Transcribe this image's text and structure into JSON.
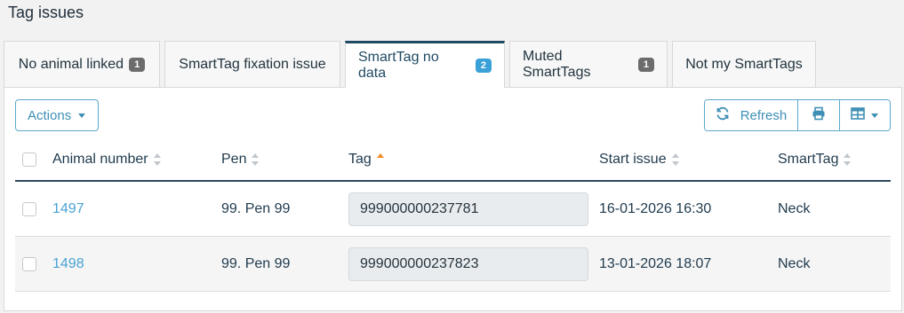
{
  "page": {
    "title": "Tag issues"
  },
  "tabs": [
    {
      "label": "No animal linked",
      "badge": "1"
    },
    {
      "label": "SmartTag fixation issue",
      "badge": ""
    },
    {
      "label": "SmartTag no data",
      "badge": "2"
    },
    {
      "label": "Muted SmartTags",
      "badge": "1"
    },
    {
      "label": "Not my SmartTags",
      "badge": ""
    }
  ],
  "toolbar": {
    "actions_label": "Actions",
    "refresh_label": "Refresh"
  },
  "table": {
    "columns": [
      "Animal number",
      "Pen",
      "Tag",
      "Start issue",
      "SmartTag"
    ],
    "sorted_column": "Tag",
    "sort_direction": "ascending",
    "rows": [
      {
        "animal_number": "1497",
        "pen": "99. Pen 99",
        "tag": "999000000237781",
        "start_issue": "16-01-2026 16:30",
        "smarttag": "Neck"
      },
      {
        "animal_number": "1498",
        "pen": "99. Pen 99",
        "tag": "999000000237823",
        "start_issue": "13-01-2026 18:07",
        "smarttag": "Neck"
      }
    ]
  },
  "icons": {
    "refresh": "refresh-icon",
    "print": "printer-icon",
    "view": "table-view-icon",
    "sort": "sort-icon"
  },
  "colors": {
    "accent": "#3f8fb6",
    "active_tab_border": "#1f4a63",
    "active_badge": "#3aa0d8",
    "badge": "#6c6c6c",
    "sort_active": "#f08a24",
    "link": "#4aa3d3"
  }
}
